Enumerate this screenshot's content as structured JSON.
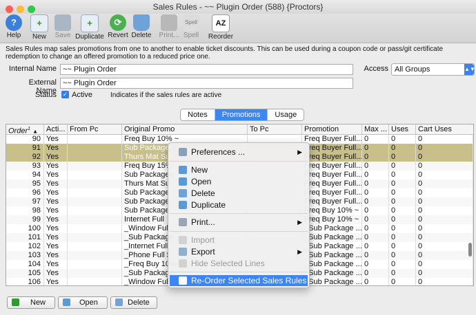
{
  "window": {
    "title": "Sales Rules - ~~ Plugin Order (588) {Proctors}"
  },
  "toolbar": {
    "help": "Help",
    "new": "New",
    "save": "Save",
    "duplicate": "Duplicate",
    "revert": "Revert",
    "delete": "Delete",
    "print": "Print...",
    "spell": "Spell",
    "spell_badge": "Spell",
    "reorder": "Reorder",
    "reorder_badge": "AZ"
  },
  "description": "Sales Rules map sales promotions from one to another to enable ticket discounts.  This can be used during a coupon code or pass/git certificate redemption to change an offered promotion to a reduced price one.",
  "form": {
    "internal_name_label": "Internal Name",
    "internal_name_value": "~~ Plugin Order",
    "external_name_label": "External Name",
    "external_name_value": "~~ Plugin Order",
    "access_label": "Access",
    "access_value": "All Groups",
    "status_label": "Status",
    "active_label": "Active",
    "active_checked": true,
    "status_note": "Indicates if the sales rules are active"
  },
  "tabs": [
    "Notes",
    "Promotions",
    "Usage"
  ],
  "active_tab": "Promotions",
  "table": {
    "columns": [
      "Order",
      "Acti...",
      "From Pc",
      "Original Promo",
      "To Pc",
      "Promotion",
      "Max ...",
      "Uses",
      "Cart Uses"
    ],
    "sort_marker": "1",
    "rows": [
      [
        "90",
        "Yes",
        "",
        "Freq Buy 10% ~",
        "",
        "Freq Buyer Full...",
        "0",
        "0",
        "0"
      ],
      [
        "91",
        "Yes",
        "",
        "Sub Package",
        "",
        "Freq Buyer Full...",
        "0",
        "0",
        "0"
      ],
      [
        "92",
        "Yes",
        "",
        "Thurs Mat Sub",
        "",
        "Freq Buyer Full...",
        "0",
        "0",
        "0"
      ],
      [
        "93",
        "Yes",
        "",
        "Freq Buy 15%",
        "",
        "Freq Buyer Full...",
        "0",
        "0",
        "0"
      ],
      [
        "94",
        "Yes",
        "",
        "Sub Packages",
        "",
        "Freq Buyer Full...",
        "0",
        "0",
        "0"
      ],
      [
        "95",
        "Yes",
        "",
        "Thurs Mat Su",
        "",
        "Freq Buyer Full...",
        "0",
        "0",
        "0"
      ],
      [
        "96",
        "Yes",
        "",
        "Sub Package",
        "",
        "Freq Buyer Full...",
        "0",
        "0",
        "0"
      ],
      [
        "97",
        "Yes",
        "",
        "Sub Package",
        "",
        "Freq Buyer Full...",
        "0",
        "0",
        "0"
      ],
      [
        "98",
        "Yes",
        "",
        "Sub Package",
        "",
        "Freq Buy 10% ~",
        "0",
        "0",
        "0"
      ],
      [
        "99",
        "Yes",
        "",
        "Internet Full",
        "",
        "Freq Buy 10% ~",
        "0",
        "0",
        "0"
      ],
      [
        "100",
        "Yes",
        "",
        "_Window Full",
        "",
        "_Sub Package ...",
        "0",
        "0",
        "0"
      ],
      [
        "101",
        "Yes",
        "",
        "_Sub Package",
        "",
        "_Sub Package ...",
        "0",
        "0",
        "0"
      ],
      [
        "102",
        "Yes",
        "",
        "_Internet Full",
        "",
        "_Sub Package ...",
        "0",
        "0",
        "0"
      ],
      [
        "103",
        "Yes",
        "",
        "_Phone Full $",
        "",
        "_Sub Package ...",
        "0",
        "0",
        "0"
      ],
      [
        "104",
        "Yes",
        "",
        "_Freq Buy 10%",
        "",
        "_Sub Package ...",
        "0",
        "0",
        "0"
      ],
      [
        "105",
        "Yes",
        "",
        "_Sub Package",
        "",
        "_Sub Package ...",
        "0",
        "0",
        "0"
      ],
      [
        "106",
        "Yes",
        "",
        "_Window Full",
        "",
        "_Sub Package ...",
        "0",
        "0",
        "0"
      ]
    ]
  },
  "context_menu": {
    "preferences": "Preferences ...",
    "new": "New",
    "open": "Open",
    "delete": "Delete",
    "duplicate": "Duplicate",
    "print": "Print...",
    "import": "Import",
    "export": "Export",
    "hide": "Hide Selected Lines",
    "reorder": "Re-Order Selected Sales Rules"
  },
  "bottom": {
    "new": "New",
    "open": "Open",
    "delete": "Delete"
  },
  "colors": {
    "accent": "#3d85f3",
    "selection": "#c8bf8a"
  }
}
